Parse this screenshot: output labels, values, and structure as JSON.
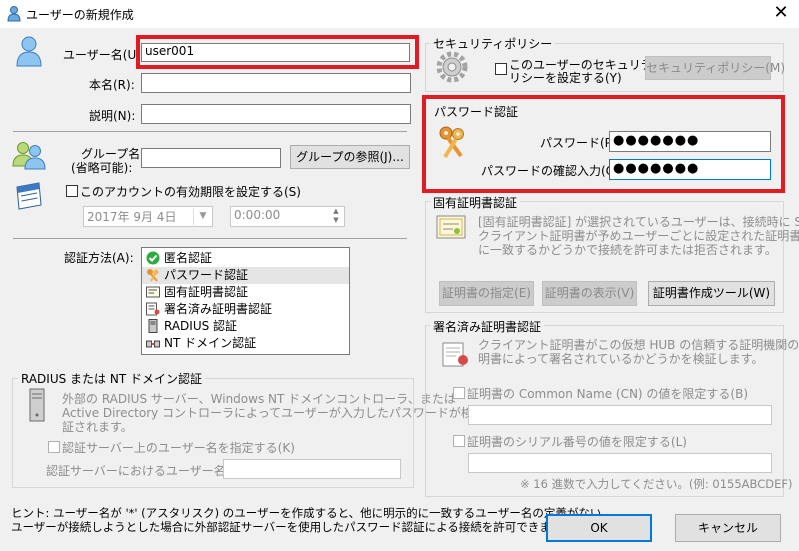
{
  "window": {
    "title": "ユーザーの新規作成",
    "close_glyph": "✕"
  },
  "user": {
    "username_label": "ユーザー名(U):",
    "username_value": "user001",
    "fullname_label": "本名(R):",
    "fullname_value": "",
    "note_label": "説明(N):",
    "note_value": "",
    "group_label_line1": "グループ名",
    "group_label_line2": "(省略可能):",
    "group_value": "",
    "group_browse_button": "グループの参照(J)...",
    "expire_checkbox_label": "このアカウントの有効期限を設定する(S)",
    "expire_date": "2017年  9月  4日",
    "expire_time": "0:00:00"
  },
  "auth": {
    "method_label": "認証方法(A):",
    "methods": [
      {
        "label": "匿名認証",
        "icon": "anonymous-check-icon",
        "selected": false
      },
      {
        "label": "パスワード認証",
        "icon": "keys-icon",
        "selected": true
      },
      {
        "label": "固有証明書認証",
        "icon": "certificate-icon",
        "selected": false
      },
      {
        "label": "署名済み証明書認証",
        "icon": "signed-certificate-icon",
        "selected": false
      },
      {
        "label": "RADIUS 認証",
        "icon": "server-icon",
        "selected": false
      },
      {
        "label": "NT ドメイン認証",
        "icon": "nt-domain-icon",
        "selected": false
      }
    ]
  },
  "radius": {
    "group_title": "RADIUS または NT ドメイン認証",
    "description_line1": "外部の RADIUS サーバー、Windows NT ドメインコントローラ、または",
    "description_line2": "Active Directory コントローラによってユーザーが入力したパスワードが検",
    "description_line3": "証されます。",
    "specify_checkbox_label": "認証サーバー上のユーザー名を指定する(K)",
    "server_username_label": "認証サーバーにおけるユーザー名(T):",
    "server_username_value": ""
  },
  "hint": {
    "line1": "ヒント: ユーザー名が '*' (アスタリスク) のユーザーを作成すると、他に明示的に一致するユーザー名の定義がない",
    "line2": "ユーザーが接続しようとした場合に外部認証サーバーを使用したパスワード認証による接続を許可できます。"
  },
  "security_policy": {
    "group_title": "セキュリティポリシー",
    "checkbox_line1": "このユーザーのセキュリティポ",
    "checkbox_line2": "リシーを設定する(Y)",
    "button": "セキュリティポリシー(M)"
  },
  "password": {
    "group_title": "パスワード認証",
    "password_label": "パスワード(P):",
    "password_value": "●●●●●●●",
    "confirm_label": "パスワードの確認入力(C):",
    "confirm_value": "●●●●●●●"
  },
  "unique_cert": {
    "group_title": "固有証明書認証",
    "description_line1": "[固有証明書認証] が選択されているユーザーは、接続時に SSL",
    "description_line2": "クライアント証明書が予めユーザーごとに設定された証明書と完全",
    "description_line3": "に一致するかどうかで接続を許可または拒否されます。",
    "specify_button": "証明書の指定(E)",
    "view_button": "証明書の表示(V)",
    "tool_button": "証明書作成ツール(W)"
  },
  "signed_cert": {
    "group_title": "署名済み証明書認証",
    "description_line1": "クライアント証明書がこの仮想 HUB の信頼する証明機関の証",
    "description_line2": "明書によって署名されているかどうかを検証します。",
    "cn_checkbox_label": "証明書の Common Name (CN) の値を限定する(B)",
    "cn_value": "",
    "serial_checkbox_label": "証明書のシリアル番号の値を限定する(L)",
    "serial_value": "",
    "serial_note": "※ 16 進数で入力してください。(例: 0155ABCDEF)"
  },
  "dialog": {
    "ok_button": "OK",
    "cancel_button": "キャンセル"
  },
  "colors": {
    "highlight": "#e11b22",
    "focus": "#0078d7",
    "icon_blue": "#5b9bd5",
    "key_orange": "#e8932e"
  }
}
